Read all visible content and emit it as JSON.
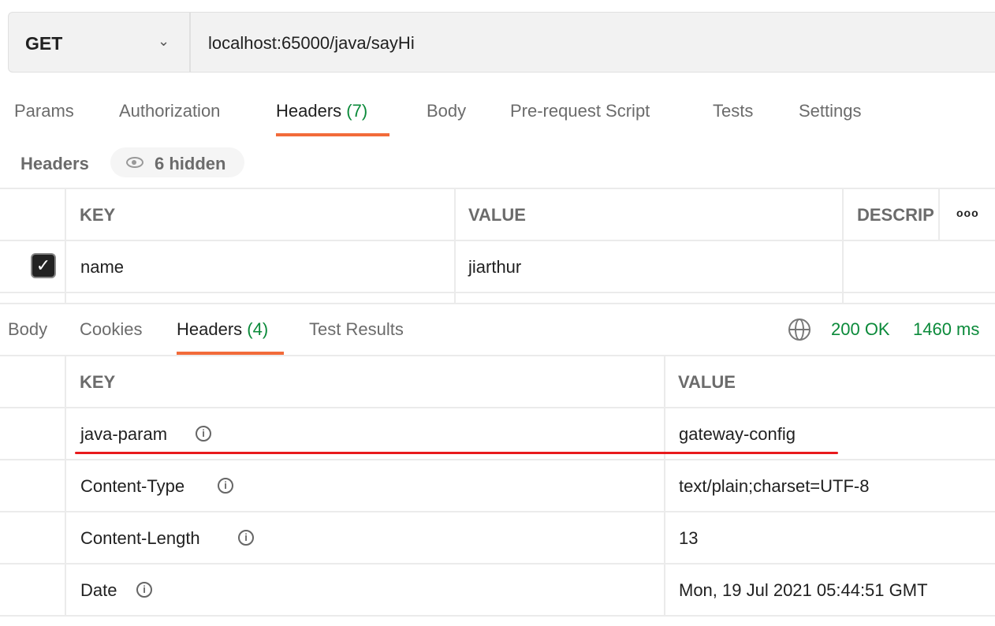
{
  "request": {
    "method": "GET",
    "url": "localhost:65000/java/sayHi"
  },
  "request_tabs": [
    {
      "label": "Params"
    },
    {
      "label": "Authorization"
    },
    {
      "label": "Headers",
      "count": "(7)"
    },
    {
      "label": "Body"
    },
    {
      "label": "Pre-request Script"
    },
    {
      "label": "Tests"
    },
    {
      "label": "Settings"
    }
  ],
  "headers_section": {
    "label": "Headers",
    "hidden": "6 hidden"
  },
  "request_table": {
    "columns": [
      "KEY",
      "VALUE",
      "DESCRIP"
    ],
    "rows": [
      {
        "key": "name",
        "value": "jiarthur",
        "checked": true
      }
    ]
  },
  "response_tabs": [
    {
      "label": "Body"
    },
    {
      "label": "Cookies"
    },
    {
      "label": "Headers",
      "count": "(4)"
    },
    {
      "label": "Test Results"
    }
  ],
  "status": {
    "code": "200 OK",
    "time": "1460 ms"
  },
  "response_table": {
    "columns": [
      "KEY",
      "VALUE"
    ],
    "rows": [
      {
        "key": "java-param",
        "value": "gateway-config"
      },
      {
        "key": "Content-Type",
        "value": "text/plain;charset=UTF-8"
      },
      {
        "key": "Content-Length",
        "value": "13"
      },
      {
        "key": "Date",
        "value": "Mon, 19 Jul 2021 05:44:51 GMT"
      }
    ]
  },
  "colors": {
    "accent": "#f26b3a",
    "success": "#0b8a3a",
    "highlight": "#e8191c"
  }
}
